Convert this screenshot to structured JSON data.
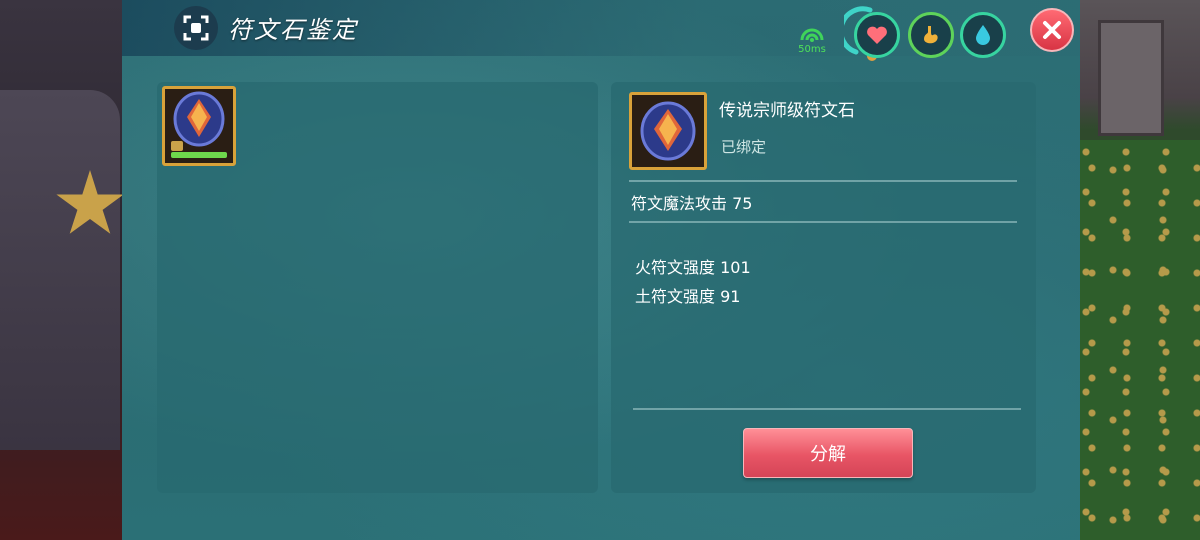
{
  "window": {
    "title": "符文石鉴定",
    "ping": "50ms"
  },
  "inventory": {
    "slots": [
      {
        "item": "传说宗师级符文石",
        "locked": true,
        "durability": 1.0
      }
    ]
  },
  "detail": {
    "name": "传说宗师级符文石",
    "bind_status": "已绑定",
    "main_stat": "符文魔法攻击 75",
    "sub_stats": [
      "火符文强度 101",
      "土符文强度 91"
    ],
    "decompose_label": "分解"
  },
  "colors": {
    "panel": "#2a6a71",
    "frame_gold": "#d9a23a",
    "button_red": "#e85565",
    "status_green": "#37d4a0"
  },
  "icons": {
    "title": "scan-frame-icon",
    "ping": "wifi-signal-icon",
    "stats": [
      "heart-icon",
      "stomach-icon",
      "water-drop-icon"
    ],
    "close": "close-icon"
  }
}
